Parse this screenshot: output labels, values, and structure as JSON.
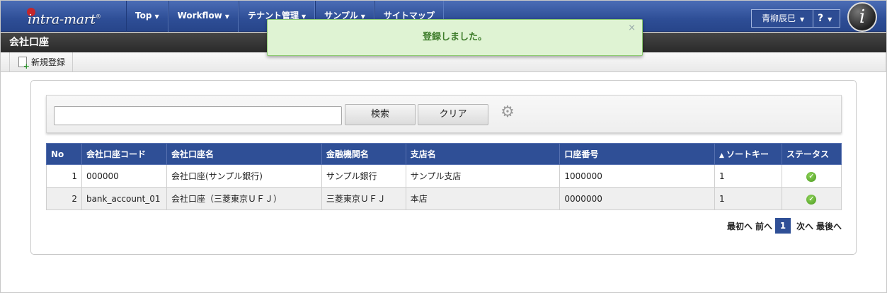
{
  "header": {
    "logo_text": "intra-mart",
    "logo_mark": "®",
    "nav": [
      {
        "label": "Top"
      },
      {
        "label": "Workflow"
      },
      {
        "label": "テナント管理"
      },
      {
        "label": "サンプル"
      },
      {
        "label": "サイトマップ"
      }
    ],
    "user_name": "青柳辰巳",
    "help_label": "?",
    "brand_letter": "i"
  },
  "page": {
    "title": "会社口座",
    "toolbar_new": "新規登録"
  },
  "toast": {
    "message": "登録しました。",
    "close": "×"
  },
  "search": {
    "value": "",
    "search_label": "検索",
    "clear_label": "クリア"
  },
  "table": {
    "headers": [
      "No",
      "会社口座コード",
      "会社口座名",
      "金融機関名",
      "支店名",
      "口座番号",
      "ソートキー",
      "ステータス"
    ],
    "rows": [
      {
        "no": "1",
        "code": "000000",
        "name": "会社口座(サンプル銀行)",
        "bank": "サンプル銀行",
        "branch": "サンプル支店",
        "account": "1000000",
        "sort": "1",
        "status": "active"
      },
      {
        "no": "2",
        "code": "bank_account_01",
        "name": "会社口座（三菱東京ＵＦＪ）",
        "bank": "三菱東京ＵＦＪ",
        "branch": "本店",
        "account": "0000000",
        "sort": "1",
        "status": "active"
      }
    ]
  },
  "pager": {
    "first": "最初へ",
    "prev": "前へ",
    "current": "1",
    "next": "次へ",
    "last": "最後へ"
  },
  "colors": {
    "nav_blue": "#2e4e96",
    "table_header": "#2f4f96",
    "toast_bg": "#dff3d3",
    "toast_text": "#3d7c2a",
    "status_ok": "#4a9a1e"
  }
}
